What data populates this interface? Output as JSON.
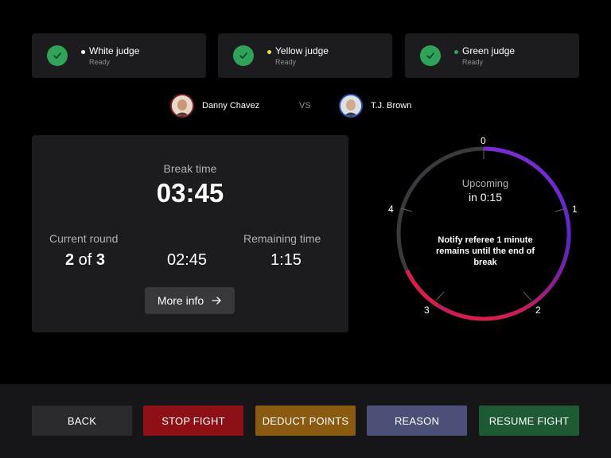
{
  "judges": [
    {
      "name": "White judge",
      "status": "Ready",
      "dot_color": "#ffffff"
    },
    {
      "name": "Yellow judge",
      "status": "Ready",
      "dot_color": "#f2e14b"
    },
    {
      "name": "Green judge",
      "status": "Ready",
      "dot_color": "#2fa35a"
    }
  ],
  "fighters": {
    "red": {
      "name": "Danny Chavez",
      "corner_color": "#7a1f2a"
    },
    "vs": "VS",
    "blue": {
      "name": "T.J. Brown",
      "corner_color": "#2c4ea8"
    }
  },
  "break_panel": {
    "break_label": "Break time",
    "break_time": "03:45",
    "round_label": "Current round",
    "round_current": "2",
    "round_of": " of ",
    "round_total": "3",
    "elapsed": "02:45",
    "remaining_label": "Remaining time",
    "remaining": "1:15",
    "more_info_label": "More info",
    "more_info_icon": "arrow-right-icon"
  },
  "dial": {
    "upcoming_label": "Upcoming",
    "upcoming_in": "in 0:15",
    "note": "Notify referee 1 minute remains until  the end of break",
    "tick_labels": [
      "0",
      "1",
      "2",
      "3",
      "4"
    ],
    "colors": {
      "track": "#3a3a3e",
      "progress_start": "#7b2bd6",
      "progress_mid": "#8a1f8e",
      "progress_end": "#d61e49"
    }
  },
  "footer": {
    "buttons": [
      {
        "label": "BACK",
        "color": "#2a2a2e"
      },
      {
        "label": "STOP FIGHT",
        "color": "#8c1016"
      },
      {
        "label": "DEDUCT POINTS",
        "color": "#8a5a10"
      },
      {
        "label": "REASON",
        "color": "#4a5077"
      },
      {
        "label": "RESUME FIGHT",
        "color": "#1d5a33"
      }
    ]
  }
}
